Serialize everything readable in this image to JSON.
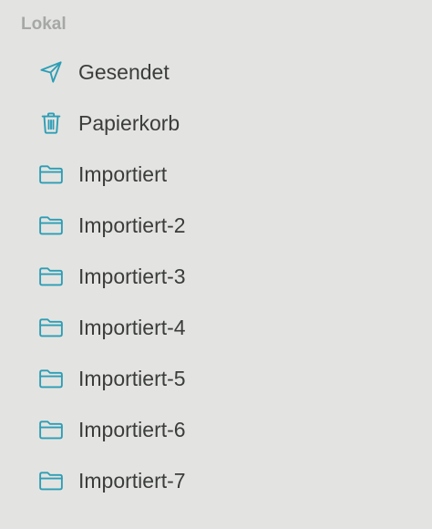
{
  "section": {
    "title": "Lokal"
  },
  "folders": [
    {
      "label": "Gesendet",
      "icon": "paper-plane-icon"
    },
    {
      "label": "Papierkorb",
      "icon": "trash-icon"
    },
    {
      "label": "Importiert",
      "icon": "folder-icon"
    },
    {
      "label": "Importiert-2",
      "icon": "folder-icon"
    },
    {
      "label": "Importiert-3",
      "icon": "folder-icon"
    },
    {
      "label": "Importiert-4",
      "icon": "folder-icon"
    },
    {
      "label": "Importiert-5",
      "icon": "folder-icon"
    },
    {
      "label": "Importiert-6",
      "icon": "folder-icon"
    },
    {
      "label": "Importiert-7",
      "icon": "folder-icon"
    }
  ],
  "colors": {
    "background": "#e3e4e1",
    "accent_icon": "#2e9db5",
    "text": "#3b3d3b",
    "section_header": "#a6a8a5"
  }
}
